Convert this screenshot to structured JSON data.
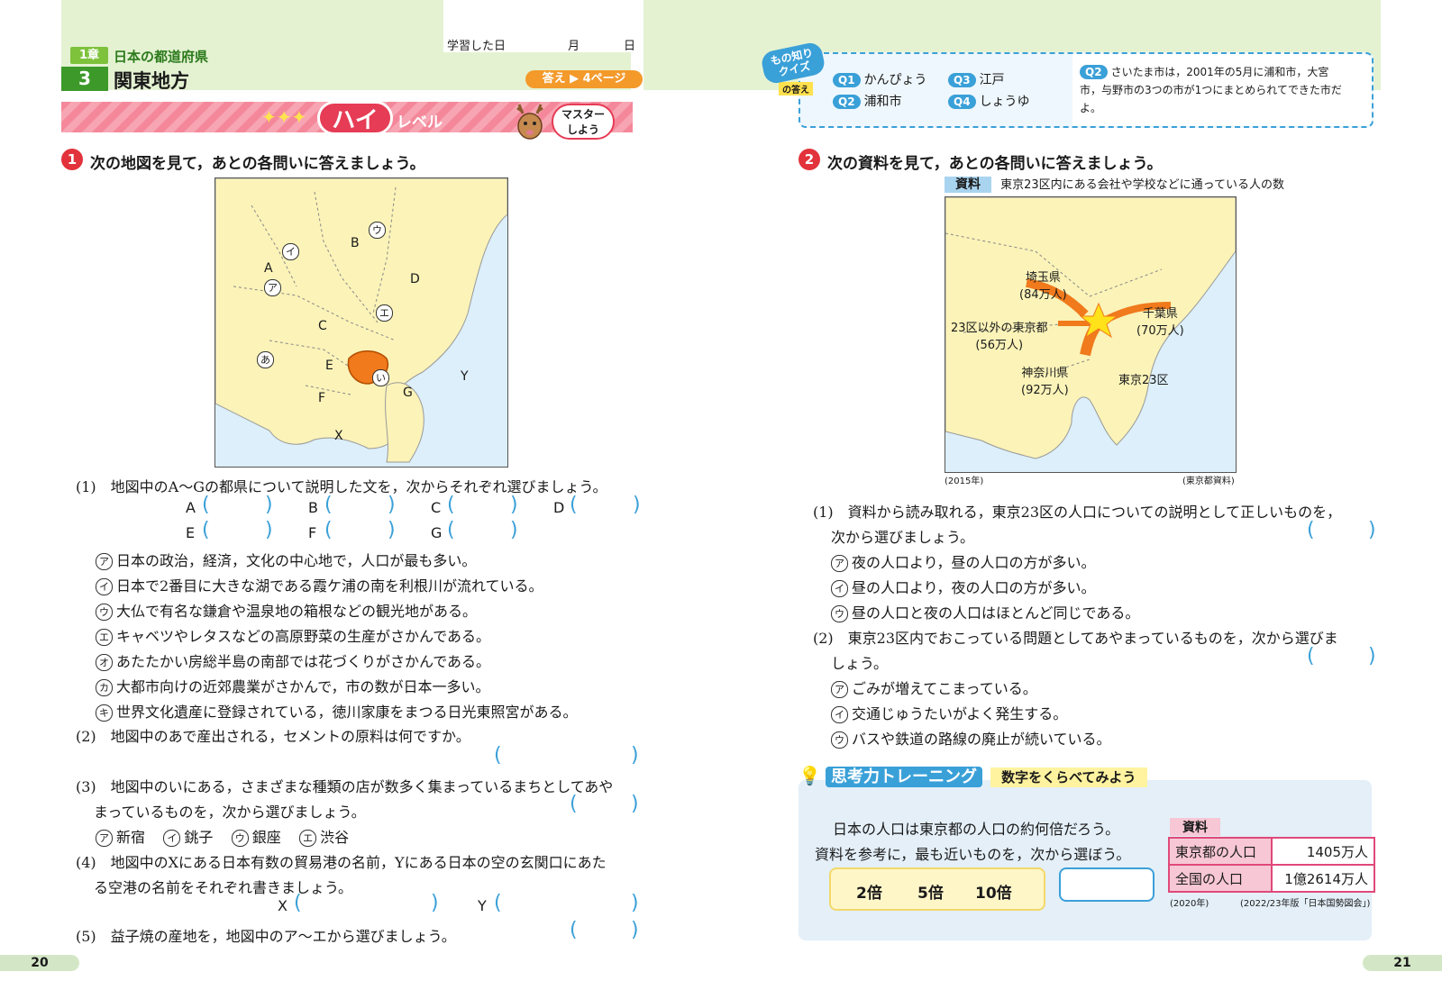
{
  "header": {
    "date_label": "学習した日",
    "month_label": "月",
    "day_label": "日",
    "chapter_badge": "1章",
    "chapter_title": "日本の都道府県",
    "unit_number": "3",
    "unit_title": "関東地方",
    "answer_ref": "答え ▶ 4ページ"
  },
  "banner": {
    "hai": "ハイ",
    "level": "レベル",
    "master_line1": "マスター",
    "master_line2": "しよう"
  },
  "q1": {
    "number": "1",
    "instruction": "次の地図を見て，あとの各問いに答えましょう。",
    "map_labels": {
      "A": "A",
      "B": "B",
      "C": "C",
      "D": "D",
      "E": "E",
      "F": "F",
      "G": "G",
      "X": "X",
      "Y": "Y",
      "a": "ア",
      "i": "イ",
      "u": "ウ",
      "e": "エ",
      "ano": "あ",
      "ino": "い"
    },
    "sub1": "(1)　地図中のA～Gの都県について説明した文を，次からそれぞれ選びましょう。",
    "slots_row1": [
      "A",
      "B",
      "C",
      "D"
    ],
    "slots_row2": [
      "E",
      "F",
      "G"
    ],
    "options": [
      {
        "mark": "ア",
        "text": "日本の政治，経済，文化の中心地で，人口が最も多い。"
      },
      {
        "mark": "イ",
        "text": "日本で2番目に大きな湖である霞ケ浦の南を利根川が流れている。"
      },
      {
        "mark": "ウ",
        "text": "大仏で有名な鎌倉や温泉地の箱根などの観光地がある。"
      },
      {
        "mark": "エ",
        "text": "キャベツやレタスなどの高原野菜の生産がさかんである。"
      },
      {
        "mark": "オ",
        "text": "あたたかい房総半島の南部では花づくりがさかんである。"
      },
      {
        "mark": "カ",
        "text": "大都市向けの近郊農業がさかんで，市の数が日本一多い。"
      },
      {
        "mark": "キ",
        "text": "世界文化遺産に登録されている，徳川家康をまつる日光東照宮がある。"
      }
    ],
    "sub2": "(2)　地図中のあで産出される，セメントの原料は何ですか。",
    "sub3_line1": "(3)　地図中のいにある，さまざまな種類の店が数多く集まっているまちとしてあや",
    "sub3_line2": "まっているものを，次から選びましょう。",
    "sub3_options": [
      {
        "mark": "ア",
        "text": "新宿"
      },
      {
        "mark": "イ",
        "text": "銚子"
      },
      {
        "mark": "ウ",
        "text": "銀座"
      },
      {
        "mark": "エ",
        "text": "渋谷"
      }
    ],
    "sub4_line1": "(4)　地図中のXにある日本有数の貿易港の名前，Yにある日本の空の玄関口にあた",
    "sub4_line2": "る空港の名前をそれぞれ書きましょう。",
    "sub4_x": "X",
    "sub4_y": "Y",
    "sub5": "(5)　益子焼の産地を，地図中のア～エから選びましょう。"
  },
  "quiz": {
    "badge_line1": "もの知り",
    "badge_line2": "クイズ",
    "badge_line3": "の答え",
    "answers": [
      {
        "q": "Q1",
        "a": "かんぴょう"
      },
      {
        "q": "Q3",
        "a": "江戸"
      },
      {
        "q": "Q2",
        "a": "浦和市"
      },
      {
        "q": "Q4",
        "a": "しょうゆ"
      }
    ],
    "explain_q": "Q2",
    "explain_line1": "さいたま市は，2001年の5月に浦和市，大宮",
    "explain_line2": "市，与野市の3つの市が1つにまとめられてできた市だ",
    "explain_line3": "よ。"
  },
  "q2": {
    "number": "2",
    "instruction": "次の資料を見て，あとの各問いに答えましょう。",
    "shiryo": "資料",
    "shiryo_title": "東京23区内にある会社や学校などに通っている人の数",
    "map_labels": {
      "saitama": "埼玉県",
      "saitama_n": "(84万人)",
      "chiba": "千葉県",
      "chiba_n": "(70万人)",
      "tokyo_other": "23区以外の東京都",
      "tokyo_other_n": "(56万人)",
      "kanagawa": "神奈川県",
      "kanagawa_n": "(92万人)",
      "tokyo23": "東京23区"
    },
    "year_note": "(2015年)",
    "source_note": "(東京都資料)",
    "sub1_line1": "(1)　資料から読み取れる，東京23区の人口についての説明として正しいものを，",
    "sub1_line2": "次から選びましょう。",
    "sub1_options": [
      {
        "mark": "ア",
        "text": "夜の人口より，昼の人口の方が多い。"
      },
      {
        "mark": "イ",
        "text": "昼の人口より，夜の人口の方が多い。"
      },
      {
        "mark": "ウ",
        "text": "昼の人口と夜の人口はほとんど同じである。"
      }
    ],
    "sub2_line1": "(2)　東京23区内でおこっている問題としてあやまっているものを，次から選びま",
    "sub2_line2": "しょう。",
    "sub2_options": [
      {
        "mark": "ア",
        "text": "ごみが増えてこまっている。"
      },
      {
        "mark": "イ",
        "text": "交通じゅうたいがよく発生する。"
      },
      {
        "mark": "ウ",
        "text": "バスや鉄道の路線の廃止が続いている。"
      }
    ]
  },
  "thinking": {
    "title": "思考力トレーニング",
    "subtitle": "数字をくらべてみよう",
    "line1": "日本の人口は東京都の人口の約何倍だろう。",
    "line2": "資料を参考に，最も近いものを，次から選ぼう。",
    "choices": [
      "2倍",
      "5倍",
      "10倍"
    ],
    "shiryo": "資料",
    "table": [
      {
        "label": "東京都の人口",
        "value": "1405万人"
      },
      {
        "label": "全国の人口",
        "value": "1億2614万人"
      }
    ],
    "year_note": "(2020年)",
    "source_note": "(2022/23年版「日本国勢図会」)"
  },
  "pages": {
    "left": "20",
    "right": "21"
  },
  "colors": {
    "green_band": "#e4f2d2",
    "accent_green": "#3d9a2a",
    "red_number": "#e2323b",
    "answer_blue": "#3aa0d8",
    "orange": "#f39a2b",
    "pink_banner": "#f4889a"
  }
}
